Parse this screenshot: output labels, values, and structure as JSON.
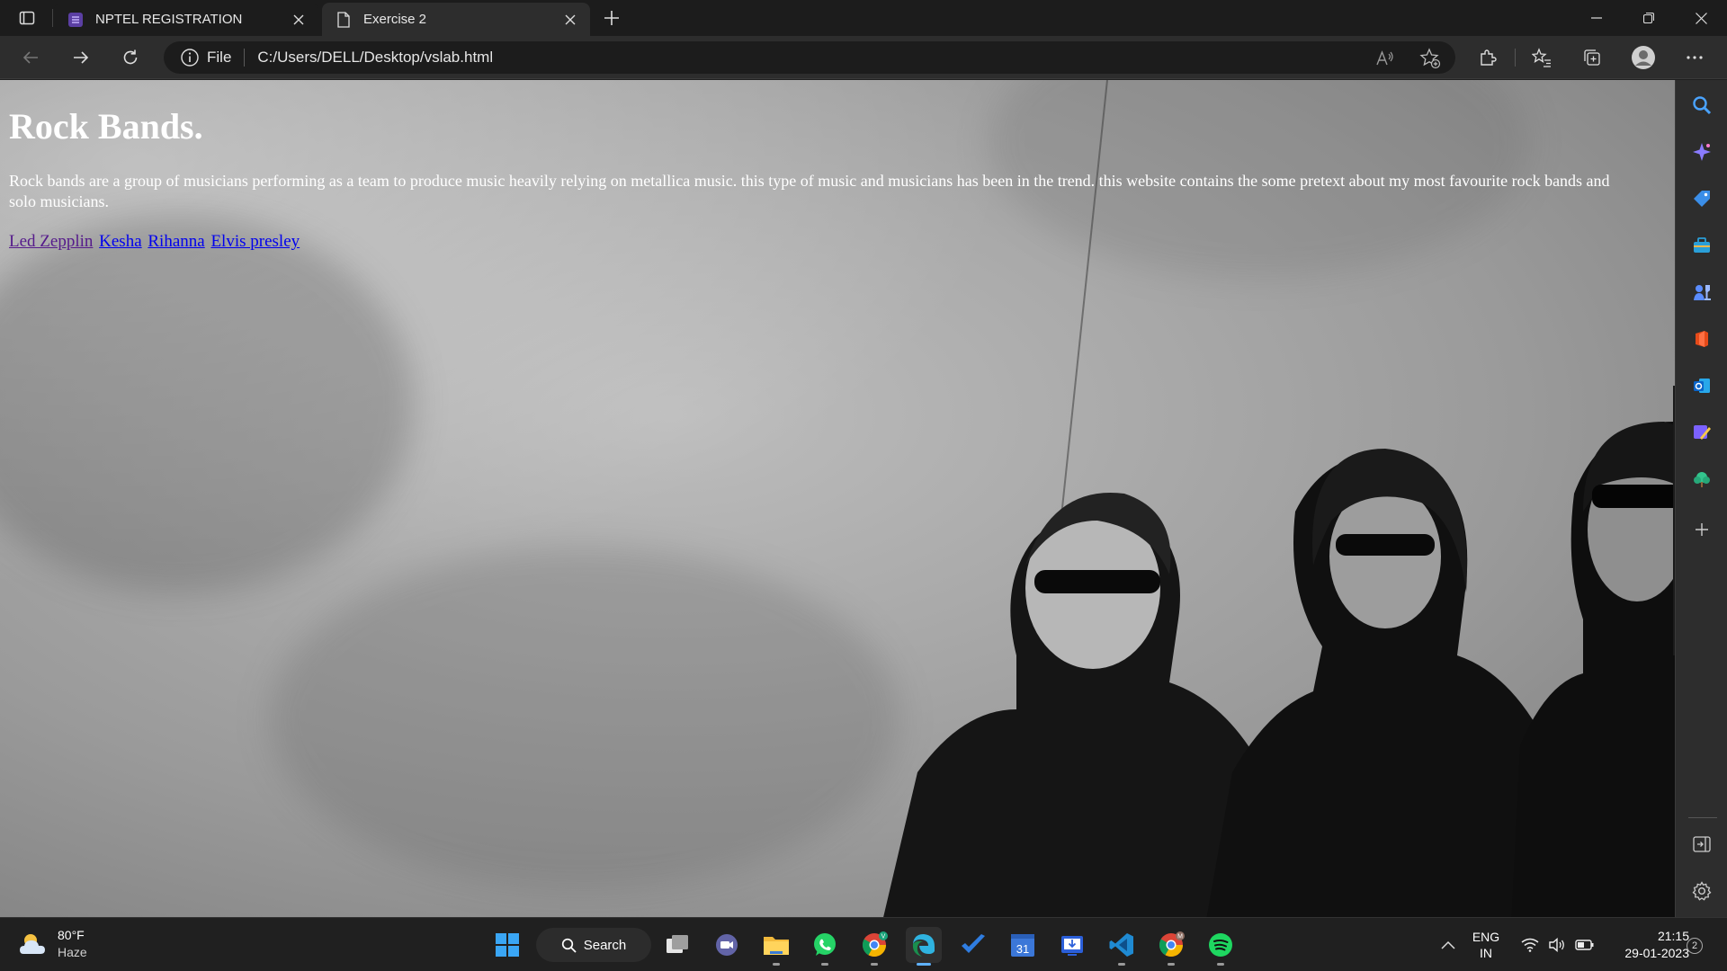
{
  "browser": {
    "tabs": [
      {
        "title": "NPTEL REGISTRATION",
        "active": false
      },
      {
        "title": "Exercise 2",
        "active": true
      }
    ],
    "address": {
      "scheme_label": "File",
      "url": "C:/Users/DELL/Desktop/vslab.html"
    }
  },
  "page": {
    "heading": "Rock Bands.",
    "paragraph": "Rock bands are a group of musicians performing as a team to produce music heavily relying on metallica music. this type of music and musicians has been in the trend. this website contains the some pretext about my most favourite rock bands and solo musicians.",
    "links": [
      {
        "label": "Led Zepplin",
        "visited": true
      },
      {
        "label": "Kesha",
        "visited": false
      },
      {
        "label": "Rihanna",
        "visited": false
      },
      {
        "label": "Elvis presley",
        "visited": false
      }
    ]
  },
  "taskbar": {
    "weather": {
      "temp": "80°F",
      "condition": "Haze"
    },
    "search_label": "Search",
    "calendar_day": "31",
    "language": {
      "line1": "ENG",
      "line2": "IN"
    },
    "clock": {
      "time": "21:15",
      "date": "29-01-2023"
    },
    "notification_count": "2"
  },
  "colors": {
    "link": "#0000ee",
    "link_visited": "#551a8b",
    "accent": "#5fb2ff"
  }
}
